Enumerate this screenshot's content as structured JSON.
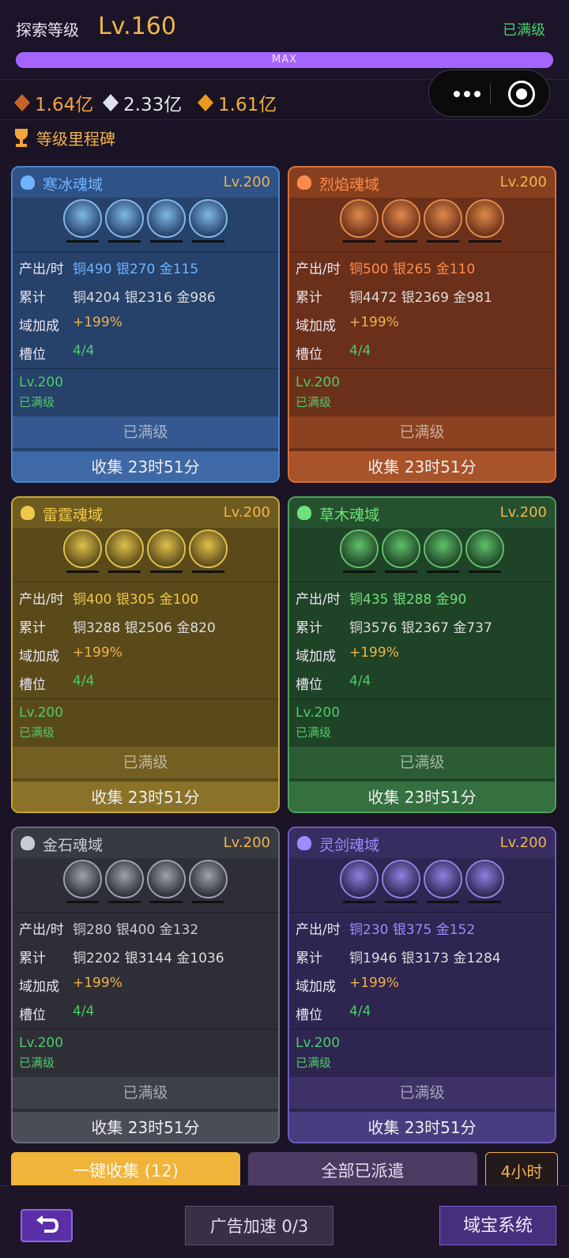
{
  "header": {
    "explore_label": "探索等级",
    "explore_level": "Lv.160",
    "maxed": "已满级",
    "xp_bar_text": "MAX",
    "xp_progress": 1.0
  },
  "currencies": [
    {
      "icon": "copper-ore-icon",
      "value": "1.64亿",
      "color": "#c8642a"
    },
    {
      "icon": "silver-crystal-icon",
      "value": "2.33亿",
      "color": "#dfe3ee"
    },
    {
      "icon": "gold-crystal-icon",
      "value": "1.61亿",
      "color": "#e89a20"
    }
  ],
  "milestone": {
    "label": "等级里程碑",
    "icon": "trophy-icon"
  },
  "stat_labels": {
    "output": "产出/时",
    "total": "累计",
    "bonus": "域加成",
    "slots": "槽位"
  },
  "domains": [
    {
      "name": "寒冰魂域",
      "level": "Lv.200",
      "icon": "ice-icon",
      "output": "铜490 银270 金115",
      "total": "铜4204 银2316 金986",
      "bonus": "+199%",
      "slots": "4/4",
      "cur_level": "Lv.200",
      "status": "已满级",
      "maxed_button": "已满级",
      "collect_button": "收集 23时51分",
      "theme": {
        "bg": "#26416a",
        "head": "#2f5287",
        "border": "#4f82c8",
        "name": "#6fb4ff",
        "output": "#6fb4ff",
        "maxed": "#355890",
        "collect": "#3f68a6",
        "av": "#7fb8e8"
      }
    },
    {
      "name": "烈焰魂域",
      "level": "Lv.200",
      "icon": "fire-icon",
      "output": "铜500 银265 金110",
      "total": "铜4472 银2369 金981",
      "bonus": "+199%",
      "slots": "4/4",
      "cur_level": "Lv.200",
      "status": "已满级",
      "maxed_button": "已满级",
      "collect_button": "收集 23时51分",
      "theme": {
        "bg": "#6b301a",
        "head": "#87401f",
        "border": "#d8713a",
        "name": "#ff8a4c",
        "output": "#ff8a4c",
        "maxed": "#8c4220",
        "collect": "#a9532a",
        "av": "#e08a4a"
      }
    },
    {
      "name": "雷霆魂域",
      "level": "Lv.200",
      "icon": "thunder-icon",
      "output": "铜400 银305 金100",
      "total": "铜3288 银2506 金820",
      "bonus": "+199%",
      "slots": "4/4",
      "cur_level": "Lv.200",
      "status": "已满级",
      "maxed_button": "已满级",
      "collect_button": "收集 23时51分",
      "theme": {
        "bg": "#5a4a1a",
        "head": "#6e5b20",
        "border": "#c8a838",
        "name": "#f0c84a",
        "output": "#f0c84a",
        "maxed": "#735f22",
        "collect": "#8a7228",
        "av": "#e0c04a"
      }
    },
    {
      "name": "草木魂域",
      "level": "Lv.200",
      "icon": "leaf-icon",
      "output": "铜435 银288 金90",
      "total": "铜3576 银2367 金737",
      "bonus": "+199%",
      "slots": "4/4",
      "cur_level": "Lv.200",
      "status": "已满级",
      "maxed_button": "已满级",
      "collect_button": "收集 23时51分",
      "theme": {
        "bg": "#1f4326",
        "head": "#25512e",
        "border": "#4fa05a",
        "name": "#6fe07a",
        "output": "#6fe07a",
        "maxed": "#2b5c34",
        "collect": "#347040",
        "av": "#5fc06a"
      }
    },
    {
      "name": "金石魂域",
      "level": "Lv.200",
      "icon": "stone-icon",
      "output": "铜280 银400 金132",
      "total": "铜2202 银3144 金1036",
      "bonus": "+199%",
      "slots": "4/4",
      "cur_level": "Lv.200",
      "status": "已满级",
      "maxed_button": "已满级",
      "collect_button": "收集 23时51分",
      "theme": {
        "bg": "#2e2f36",
        "head": "#383a42",
        "border": "#6a6d78",
        "name": "#c9cbd4",
        "output": "#c9cbd4",
        "maxed": "#3e4049",
        "collect": "#4a4d57",
        "av": "#9ea2ae"
      }
    },
    {
      "name": "灵剑魂域",
      "level": "Lv.200",
      "icon": "sword-icon",
      "output": "铜230 银375 金152",
      "total": "铜1946 银3173 金1284",
      "bonus": "+199%",
      "slots": "4/4",
      "cur_level": "Lv.200",
      "status": "已满级",
      "maxed_button": "已满级",
      "collect_button": "收集 23时51分",
      "theme": {
        "bg": "#2e2550",
        "head": "#372d60",
        "border": "#6d5cc0",
        "name": "#9f8aff",
        "output": "#9f8aff",
        "maxed": "#3d3168",
        "collect": "#4a3c80",
        "av": "#8e80e0"
      }
    }
  ],
  "actions": {
    "collect_all": "一键收集 (12)",
    "all_dispatched": "全部已派遣",
    "duration": "4小时"
  },
  "footer": {
    "back": "back-icon",
    "ad_boost": "广告加速 0/3",
    "treasure": "域宝系统"
  }
}
